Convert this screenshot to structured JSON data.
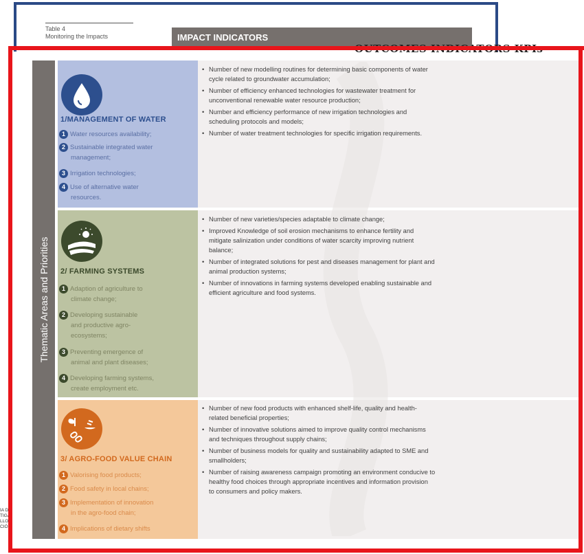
{
  "caption": {
    "table_number": "Table 4",
    "table_title": "Monitoring the Impacts"
  },
  "header": {
    "impact_title": "IMPACT INDICATORS",
    "outcomes_title": "OUTCOMES INDICATORS KPIs"
  },
  "sidebar_label": "Thematic Areas and Priorities",
  "areas": [
    {
      "title": "1/MANAGEMENT OF WATER",
      "icon": "water-drop-icon",
      "color": "#2d4f8e",
      "priorities": [
        {
          "num": "1",
          "lines": [
            "Water resources availability;"
          ]
        },
        {
          "num": "2",
          "lines": [
            "Sustainable integrated water",
            "management;"
          ]
        },
        {
          "num": "3",
          "lines": [
            "Irrigation technologies;"
          ]
        },
        {
          "num": "4",
          "lines": [
            "Use of alternative water",
            "resources."
          ]
        }
      ],
      "indicators": [
        [
          "Number of new modelling routines for determining basic components of water",
          "cycle related to groundwater accumulation;"
        ],
        [
          "Number of efficiency enhanced technologies for wastewater treatment for",
          "unconventional renewable water resource production;"
        ],
        [
          "Number and efficiency performance of new irrigation technologies and",
          "scheduling protocols and models;"
        ],
        [
          "Number of water treatment technologies for specific irrigation requirements."
        ]
      ]
    },
    {
      "title": "2/ FARMING SYSTEMS",
      "icon": "farm-field-icon",
      "color": "#3c4a2c",
      "priorities": [
        {
          "num": "1",
          "lines": [
            "Adaption of agriculture to",
            "climate change;"
          ]
        },
        {
          "num": "2",
          "lines": [
            "Developing sustainable",
            "and productive agro-",
            "ecosystems;"
          ]
        },
        {
          "num": "3",
          "lines": [
            "Preventing emergence of",
            "animal and plant diseases;"
          ]
        },
        {
          "num": "4",
          "lines": [
            "Developing farming systems,",
            "create employment etc."
          ]
        }
      ],
      "indicators": [
        [
          "Number of new varieties/species adaptable to climate change;"
        ],
        [
          "Improved Knowledge of soil erosion mechanisms to enhance fertility and",
          "mitigate salinization under conditions of water scarcity improving nutrient",
          "balance;"
        ],
        [
          "Number of integrated solutions for pest and diseases management for plant and",
          "animal production systems;"
        ],
        [
          "Number of innovations in farming systems developed enabling sustainable and",
          "efficient agriculture and food systems."
        ]
      ]
    },
    {
      "title": "3/ AGRO-FOOD VALUE CHAIN",
      "icon": "food-chain-icon",
      "color": "#d2691e",
      "priorities": [
        {
          "num": "1",
          "lines": [
            "Valorising food products;"
          ]
        },
        {
          "num": "2",
          "lines": [
            "Food safety in local chains;"
          ]
        },
        {
          "num": "3",
          "lines": [
            "Implementation of innovation",
            "in the agro-food chain;"
          ]
        },
        {
          "num": "4",
          "lines": [
            "Implications of dietary shifts"
          ]
        }
      ],
      "indicators": [
        [
          "Number of new food products with enhanced shelf-life, quality and health-",
          "related beneficial properties;"
        ],
        [
          "Number of innovative solutions aimed to improve quality control mechanisms",
          "and techniques throughout supply chains;"
        ],
        [
          "Number of business models for quality and sustainability adapted to SME and",
          "smallholders;"
        ],
        [
          "Number of raising awareness campaign promoting an environment conducive to",
          "healthy food choices through appropriate incentives and information provision",
          "to consumers and policy makers."
        ]
      ]
    }
  ],
  "left_edge_text": [
    "ÍA D",
    "TIGA",
    "LLO",
    "CIÓ"
  ]
}
